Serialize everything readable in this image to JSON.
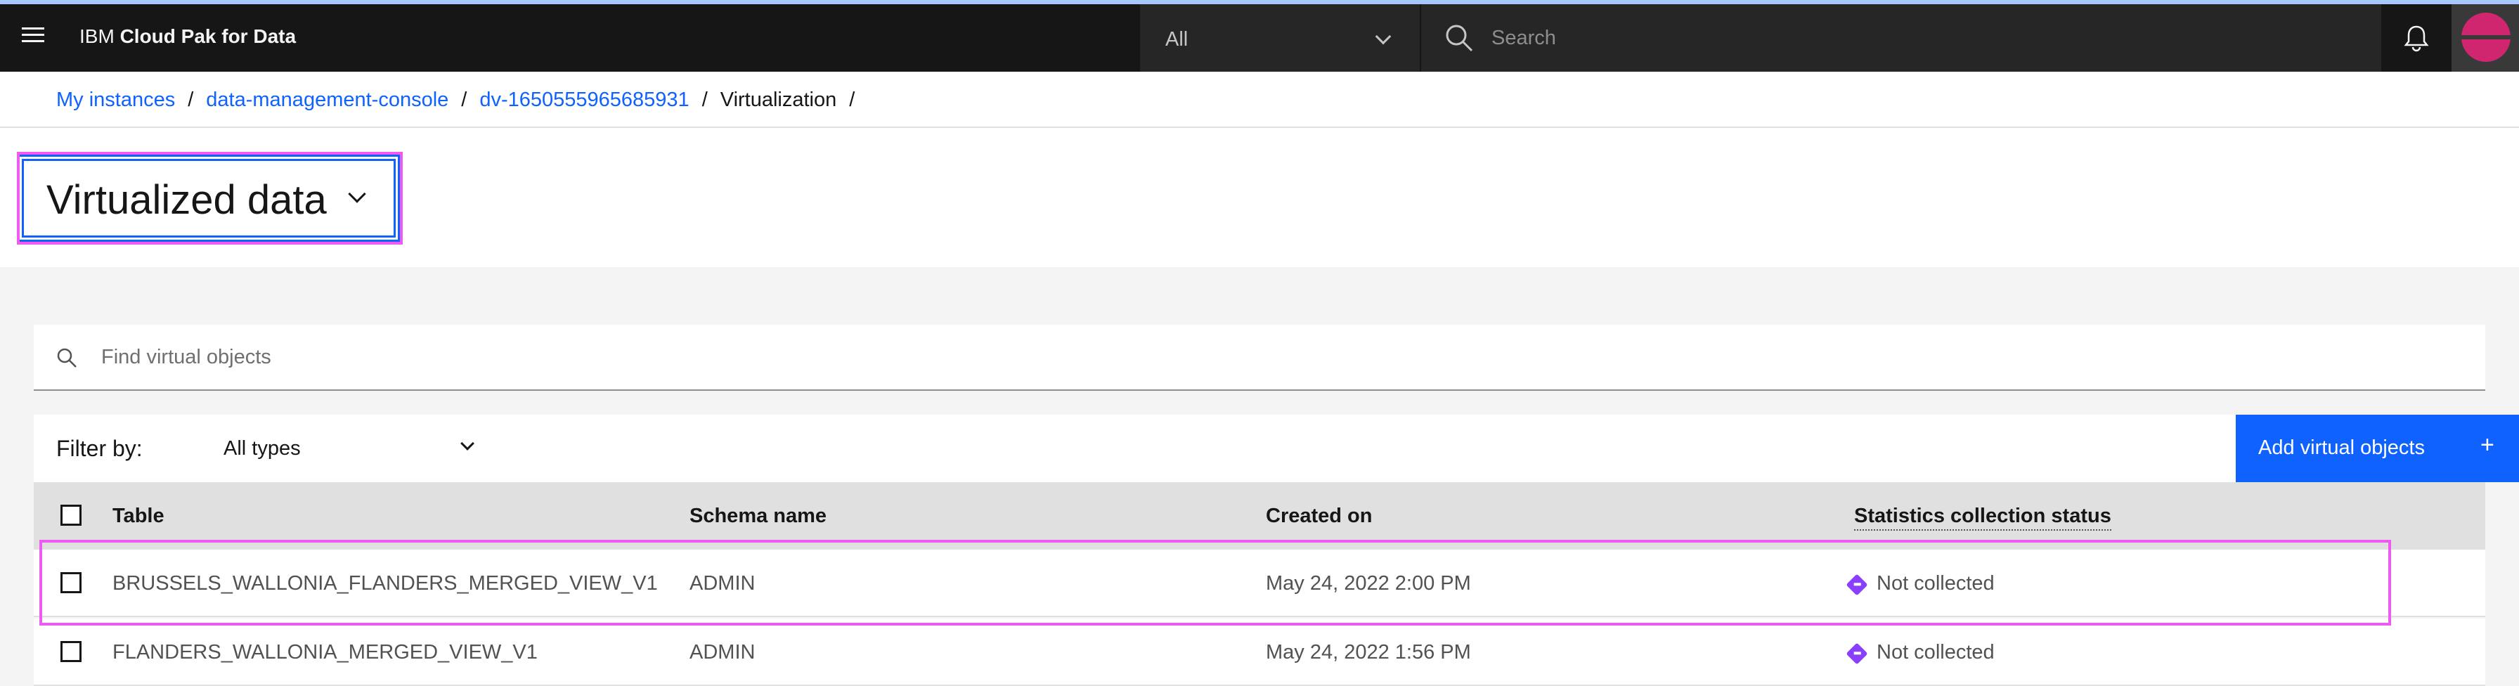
{
  "header": {
    "brand_prefix": "IBM",
    "brand_name": "Cloud Pak for Data",
    "scope_value": "All",
    "search_placeholder": "Search"
  },
  "breadcrumb": {
    "items": [
      "My instances",
      "data-management-console",
      "dv-1650555965685931"
    ],
    "current": "Virtualization",
    "separator": "/"
  },
  "page": {
    "title": "Virtualized data"
  },
  "find": {
    "placeholder": "Find virtual objects"
  },
  "toolbar": {
    "filter_label": "Filter by:",
    "filter_value": "All types",
    "add_button_label": "Add virtual objects",
    "add_button_icon": "+"
  },
  "table": {
    "columns": [
      "Table",
      "Schema name",
      "Created on",
      "Statistics collection status"
    ],
    "rows": [
      {
        "table": "BRUSSELS_WALLONIA_FLANDERS_MERGED_VIEW_V1",
        "schema": "ADMIN",
        "created": "May 24, 2022 2:00 PM",
        "status": "Not collected"
      },
      {
        "table": "FLANDERS_WALLONIA_MERGED_VIEW_V1",
        "schema": "ADMIN",
        "created": "May 24, 2022 1:56 PM",
        "status": "Not collected"
      }
    ]
  },
  "colors": {
    "accent": "#0f62fe",
    "header_bg": "#161616",
    "highlight": "#ee5bf0",
    "status_icon": "#8a3ffc",
    "avatar": "#d02670"
  }
}
